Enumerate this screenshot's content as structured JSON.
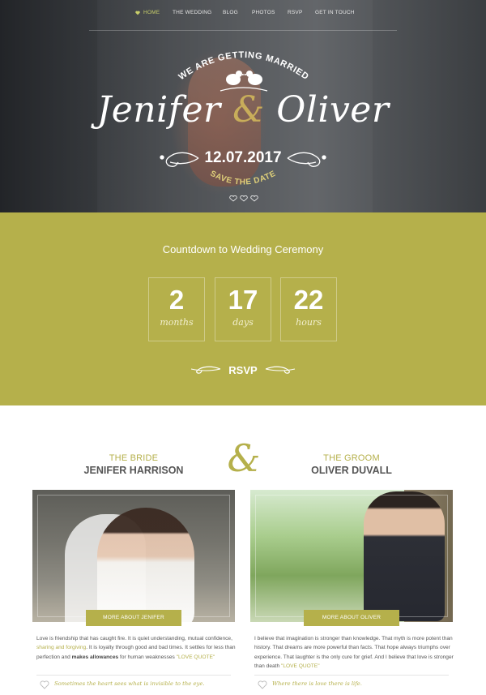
{
  "nav": {
    "items": [
      {
        "label": "Home",
        "active": true
      },
      {
        "label": "The Wedding"
      },
      {
        "label": "Blog"
      },
      {
        "label": "Photos"
      },
      {
        "label": "RSVP"
      },
      {
        "label": "Get in Touch"
      }
    ],
    "active_icon": "heart-icon"
  },
  "hero": {
    "arc_text": "WE ARE GETTING MARRIED",
    "bride_first": "Jenifer",
    "ampersand": "&",
    "groom_first": "Oliver",
    "date": "12.07.2017",
    "save_the_date": "SAVE THE DATE",
    "birds_icon": "lovebirds-icon",
    "dots_icon": "hearts-icon"
  },
  "countdown": {
    "title": "Countdown to Wedding Ceremony",
    "units": [
      {
        "value": "2",
        "label": "months"
      },
      {
        "value": "17",
        "label": "days"
      },
      {
        "value": "22",
        "label": "hours"
      }
    ],
    "rsvp_label": "RSVP"
  },
  "couple": {
    "ampersand": "&",
    "bride": {
      "role": "THE BRIDE",
      "name": "JENIFER HARRISON",
      "button": "MORE ABOUT JENIFER",
      "bio_1": "Love is friendship that has caught fire. It is quiet understanding, mutual confidence, ",
      "bio_hl": "sharing and forgiving",
      "bio_2": ". It is loyalty through good and bad times. It settles for less than perfection and ",
      "bio_bold": "makes allowances",
      "bio_3": " for human weaknesses ",
      "bio_quote": "\"LOVE QUOTE\"",
      "quote": "Sometimes the heart sees what is invisible to the eye."
    },
    "groom": {
      "role": "THE GROOM",
      "name": "OLIVER DUVALL",
      "button": "MORE ABOUT OLIVER",
      "bio_1": "I believe that imagination is stronger than knowledge. That myth is more potent than history. That dreams are more powerful than facts. That hope always triumphs over experience. That laughter is the only cure for grief. And I believe that love is stronger than death ",
      "bio_quote": "\"LOVE QUOTE\"",
      "quote": "Where there is love there is life."
    }
  },
  "colors": {
    "accent": "#b5b04b",
    "gold": "#c8ad5a",
    "white": "#ffffff",
    "text": "#555555"
  }
}
